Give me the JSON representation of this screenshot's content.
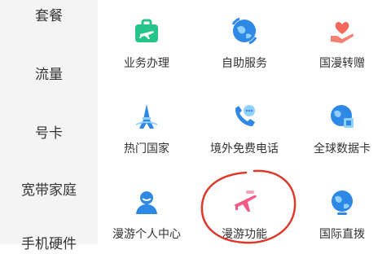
{
  "sidebar": {
    "items": [
      {
        "label": "套餐"
      },
      {
        "label": "流量"
      },
      {
        "label": "号卡"
      },
      {
        "label": "宽带家庭"
      },
      {
        "label": "手机硬件"
      }
    ]
  },
  "services": [
    {
      "label": "业务办理",
      "icon": "briefcase-plane-icon",
      "color": "#27c48a"
    },
    {
      "label": "自助服务",
      "icon": "globe-rotate-icon",
      "color": "#2e88e6"
    },
    {
      "label": "国漫转赠",
      "icon": "heart-hand-icon",
      "color": "#f2685a"
    },
    {
      "label": "热门国家",
      "icon": "tower-landmark-icon",
      "color": "#2e88e6"
    },
    {
      "label": "境外免费电话",
      "icon": "phone-chat-icon",
      "color": "#2e88e6"
    },
    {
      "label": "全球数据卡",
      "icon": "globe-card-icon",
      "color": "#2e88e6"
    },
    {
      "label": "漫游个人中心",
      "icon": "user-icon",
      "color": "#2e88e6"
    },
    {
      "label": "漫游功能",
      "icon": "plane-icon",
      "color": "#f25a85"
    },
    {
      "label": "国际直拨",
      "icon": "globe-phone-icon",
      "color": "#2e88e6"
    }
  ],
  "annotation": {
    "color": "#e0372b"
  }
}
